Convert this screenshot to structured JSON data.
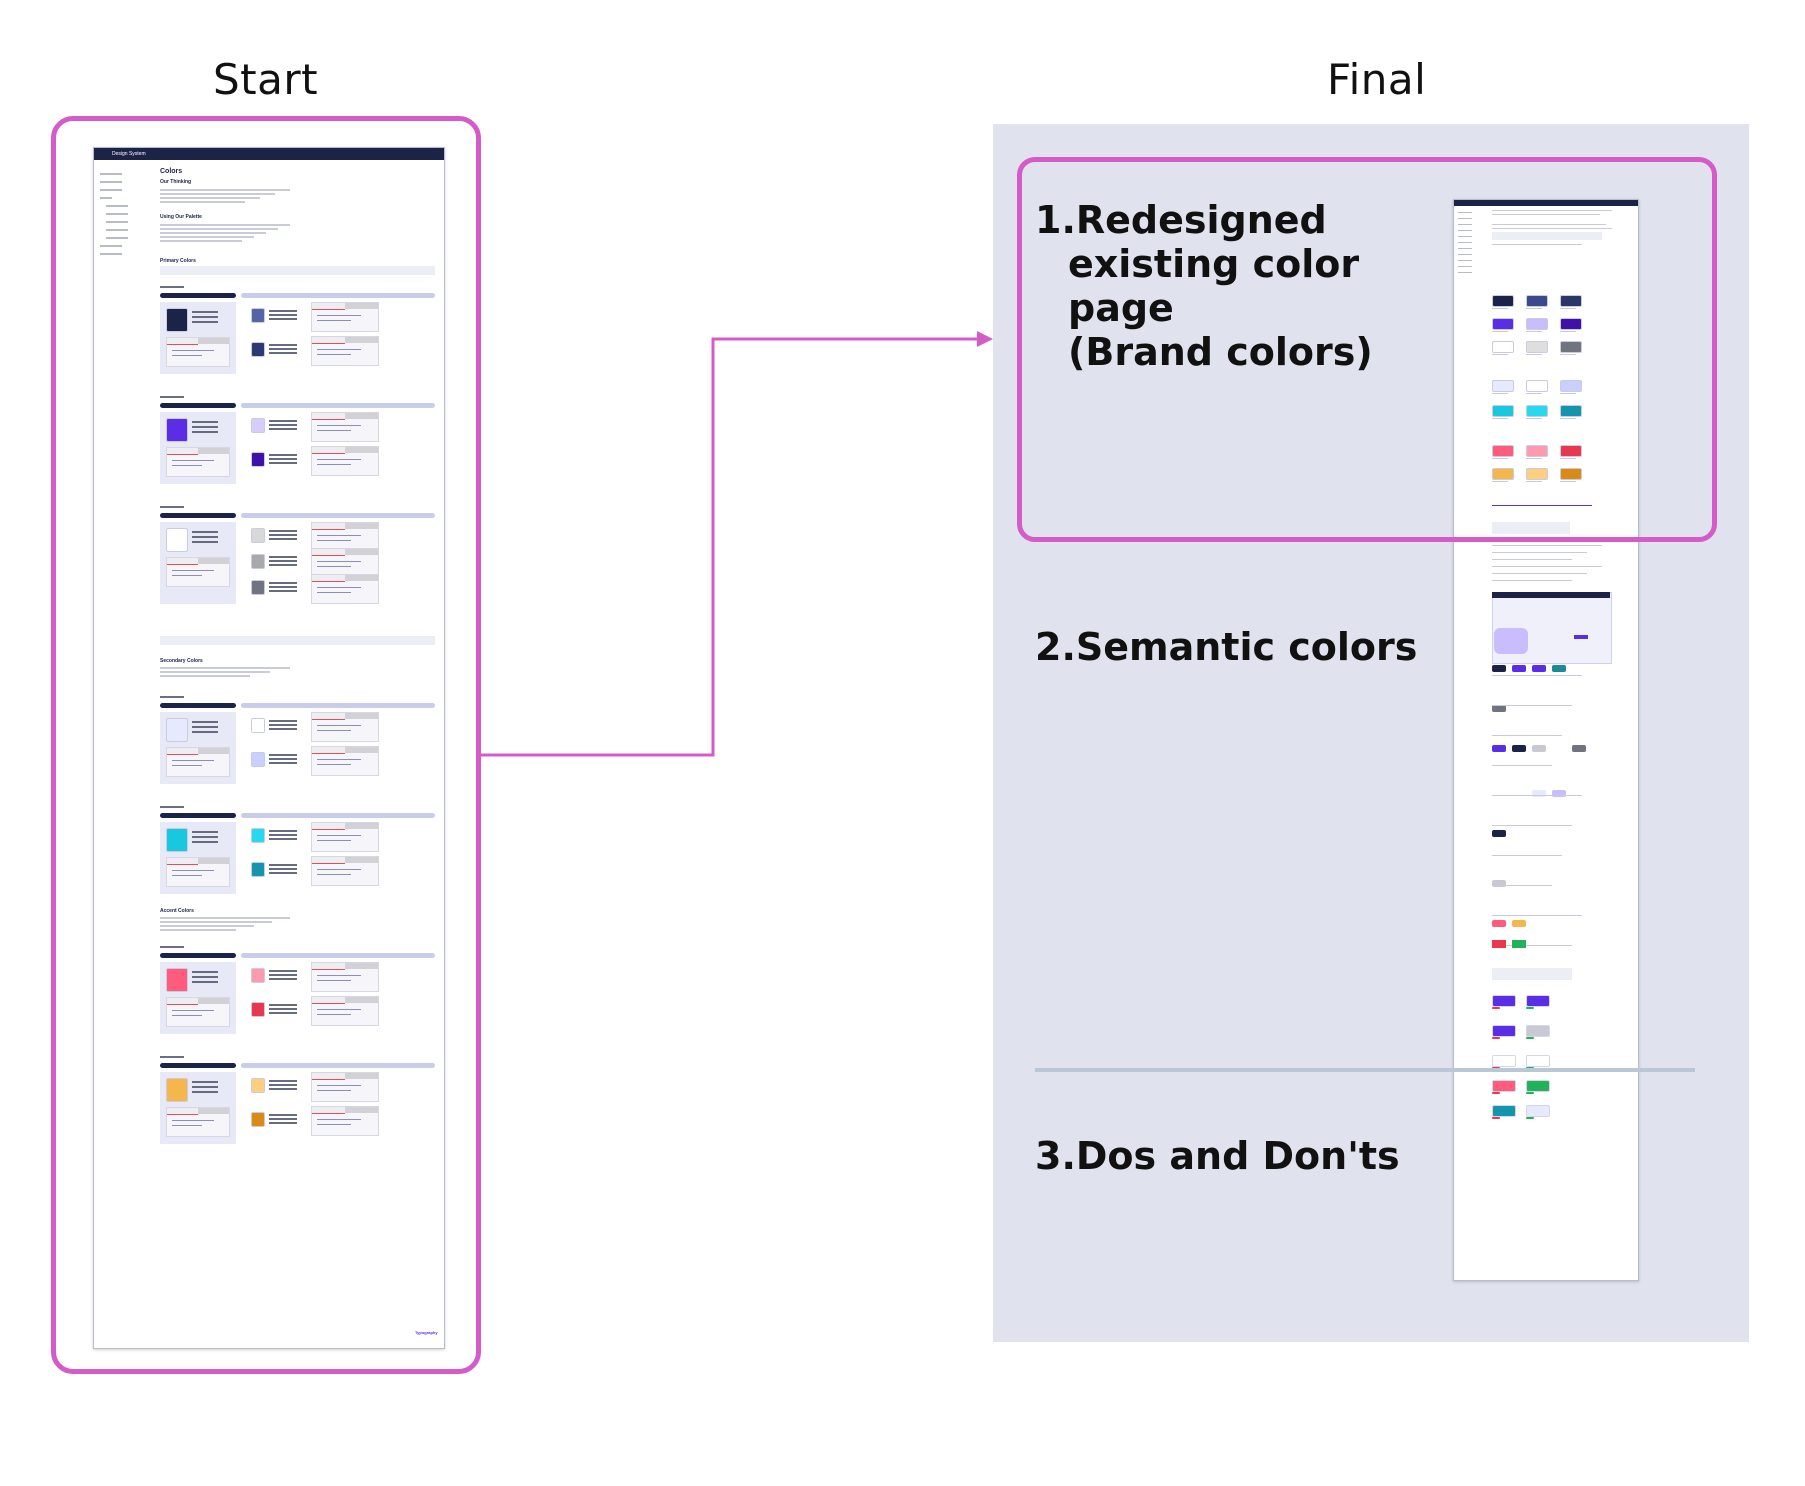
{
  "headings": {
    "start": "Start",
    "final": "Final"
  },
  "start_page": {
    "header_title": "Design System",
    "page_title": "Colors",
    "nav_items": [
      "Introduction",
      "Mini Banner",
      "Logo guidelines",
      "Colors",
      "Our Thinking",
      "Using Our Palette",
      "Primary Colors",
      "Secondary Colors",
      "Accent Colors",
      "Typography",
      "Grand Icons"
    ],
    "sections": [
      "Our Thinking",
      "Using Our Palette",
      "Primary Colors",
      "Secondary Colors",
      "Accent Colors"
    ],
    "footer_link": "Typography"
  },
  "final_sections": [
    {
      "lines": [
        "1.Redesigned",
        "existing color page",
        "(Brand colors)"
      ]
    },
    {
      "lines": [
        "2.Semantic colors"
      ]
    },
    {
      "lines": [
        "3.Dos and Don'ts"
      ]
    }
  ],
  "colors": {
    "highlight": "#d45bc8",
    "panel": "#e0e3ee",
    "navy": "#1b2348",
    "purple": "#5a2ee6",
    "divider": "#b8c8d6"
  }
}
